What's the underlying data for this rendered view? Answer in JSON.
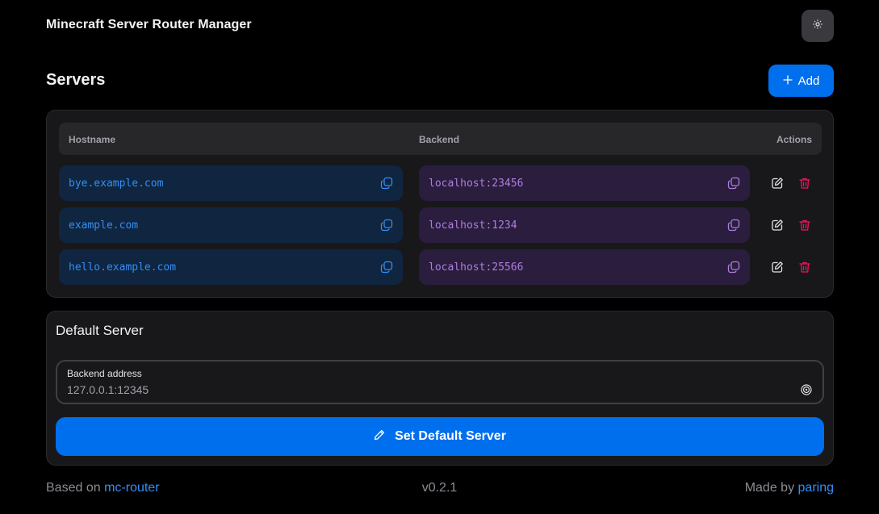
{
  "app": {
    "title": "Minecraft Server Router Manager"
  },
  "header": {
    "theme_toggle_icon": "sun-icon"
  },
  "servers": {
    "title": "Servers",
    "add_label": "Add",
    "columns": {
      "hostname": "Hostname",
      "backend": "Backend",
      "actions": "Actions"
    },
    "rows": [
      {
        "hostname": "bye.example.com",
        "backend": "localhost:23456"
      },
      {
        "hostname": "example.com",
        "backend": "localhost:1234"
      },
      {
        "hostname": "hello.example.com",
        "backend": "localhost:25566"
      }
    ]
  },
  "default_server": {
    "title": "Default Server",
    "input_label": "Backend address",
    "input_value": "127.0.0.1:12345",
    "button_label": "Set Default Server"
  },
  "footer": {
    "based_on_prefix": "Based on ",
    "based_on_link": "mc-router",
    "version": "v0.2.1",
    "made_by_prefix": "Made by ",
    "made_by_link": "paring"
  },
  "colors": {
    "accent": "#006fee",
    "hostname_text": "#338ef7",
    "backend_text": "#ae7ede",
    "danger": "#f31260"
  }
}
